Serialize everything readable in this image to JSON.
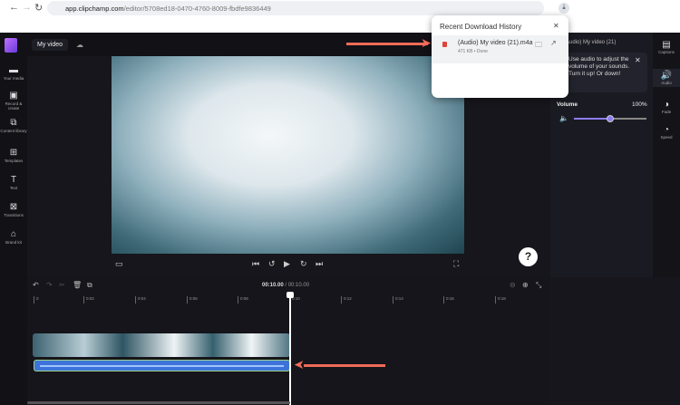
{
  "browser": {
    "back": "←",
    "forward": "→",
    "reload": "↻",
    "url_host": "app.clipchamp.com",
    "url_path": "/editor/5708ed18-0470-4760-8009-fbdfe9836449"
  },
  "header": {
    "project_title": "My video"
  },
  "sidebar": {
    "items": [
      {
        "label": "Your media",
        "icon": "▬"
      },
      {
        "label": "Record & create",
        "icon": "▣"
      },
      {
        "label": "Content library",
        "icon": "⧉"
      },
      {
        "label": "Templates",
        "icon": "⊞"
      },
      {
        "label": "Text",
        "icon": "T"
      },
      {
        "label": "Transitions",
        "icon": "⊠"
      },
      {
        "label": "Brand kit",
        "icon": "⌂"
      }
    ]
  },
  "downloads": {
    "title": "Recent Download History",
    "file_name": "(Audio) My video (21).m4a",
    "file_meta": "471 KB • Done"
  },
  "right_panel": {
    "clip_title": "(Audio) My video (21)",
    "tip": "Use audio to adjust the volume of your sounds. Turn it up! Or down!",
    "volume_label": "Volume",
    "volume_value": "100%",
    "volume_fraction": 0.5
  },
  "right_strip": [
    {
      "label": "Captions",
      "icon": "▤"
    },
    {
      "label": "Audio",
      "icon": "🔊"
    },
    {
      "label": "Fade",
      "icon": "◑"
    },
    {
      "label": "Speed",
      "icon": "◔"
    }
  ],
  "timeline": {
    "current": "00:10.00",
    "total": " / 00:10.00",
    "ticks": [
      "0",
      "0:02",
      "0:04",
      "0:06",
      "0:08",
      "0:10",
      "0:12",
      "0:14",
      "0:16",
      "0:18"
    ]
  },
  "help": "?"
}
